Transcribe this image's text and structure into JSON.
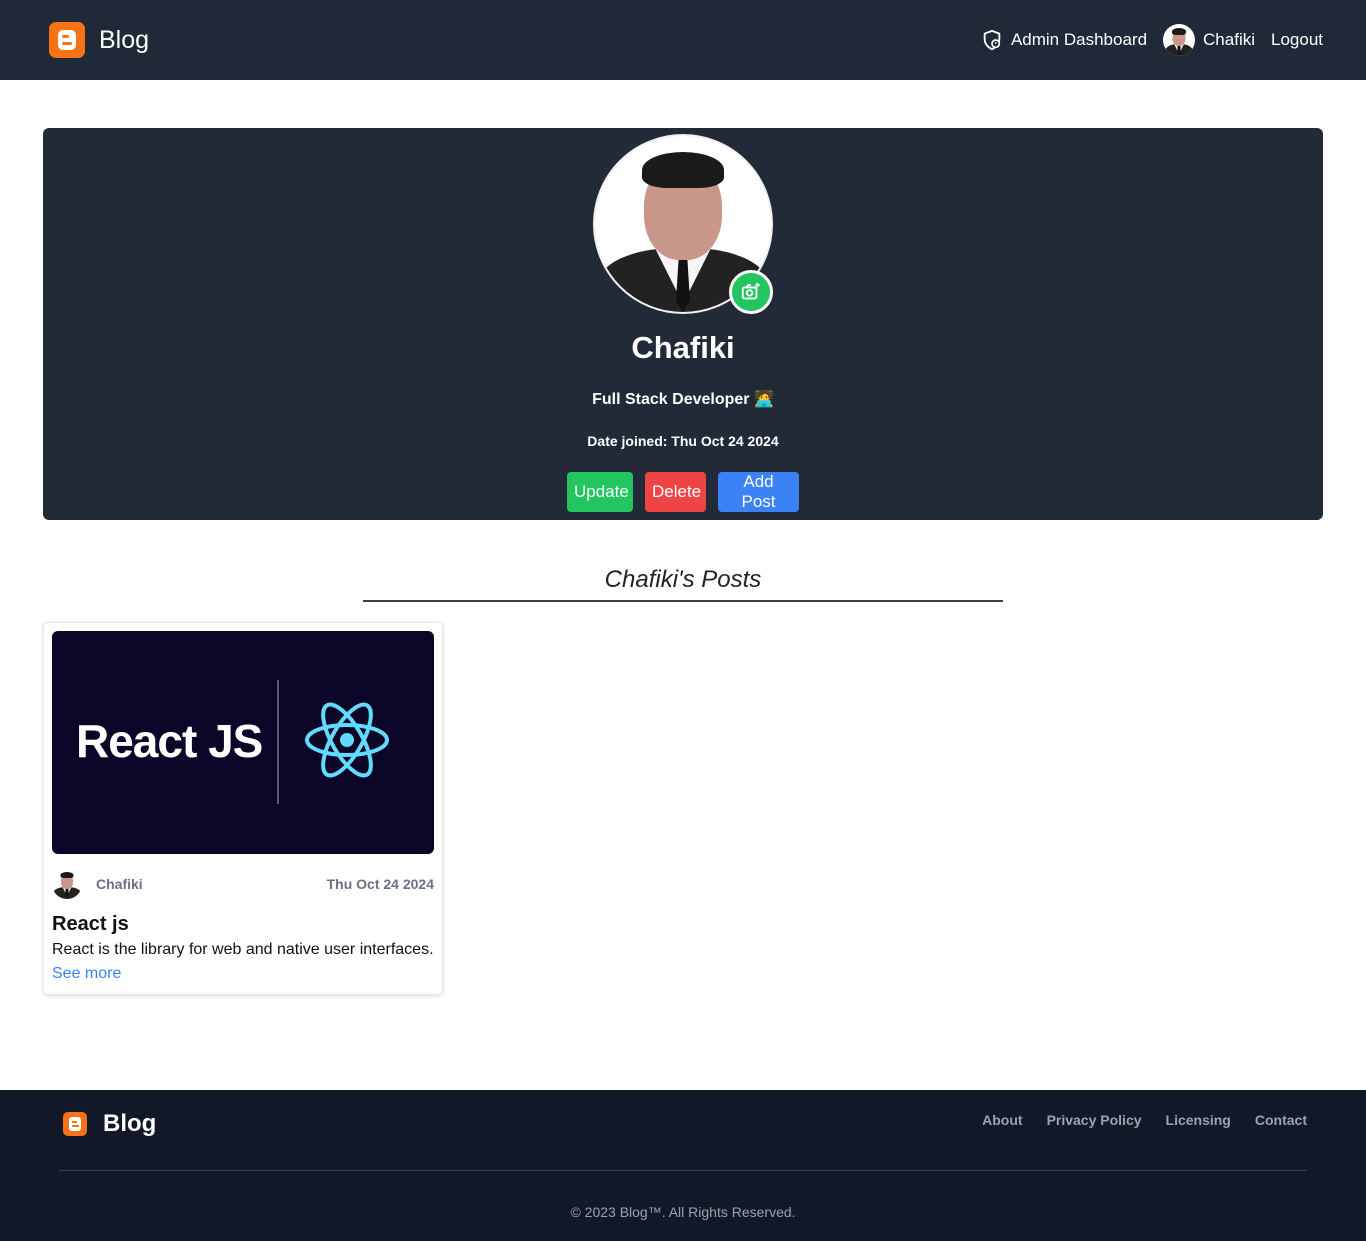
{
  "header": {
    "brand": "Blog",
    "admin_label": "Admin Dashboard",
    "user_name": "Chafiki",
    "logout_label": "Logout"
  },
  "profile": {
    "name": "Chafiki",
    "bio": "Full Stack Developer 🧑‍💻",
    "date_joined": "Date joined: Thu Oct 24 2024",
    "update_label": "Update",
    "delete_label": "Delete",
    "add_post_label": "Add Post"
  },
  "posts_section": {
    "title": "Chafiki's Posts",
    "posts": [
      {
        "image_text": "React JS",
        "author": "Chafiki",
        "date": "Thu Oct 24 2024",
        "title": "React js",
        "description": "React is the library for web and native user interfaces.",
        "link_label": "See more"
      }
    ]
  },
  "footer": {
    "brand": "Blog",
    "links": [
      "About",
      "Privacy Policy",
      "Licensing",
      "Contact"
    ],
    "copyright": "© 2023 Blog™. All Rights Reserved."
  },
  "colors": {
    "navbar_bg": "#1f2937",
    "profile_bg": "#222a38",
    "footer_bg": "#111827",
    "brand_orange": "#f97316",
    "green": "#22c55e",
    "red": "#ef4444",
    "blue": "#3b82f6"
  },
  "icons": {
    "brand_logo": "blogger-logo-icon",
    "admin": "shield-user-icon",
    "camera": "camera-plus-icon",
    "react": "react-atom-icon"
  }
}
